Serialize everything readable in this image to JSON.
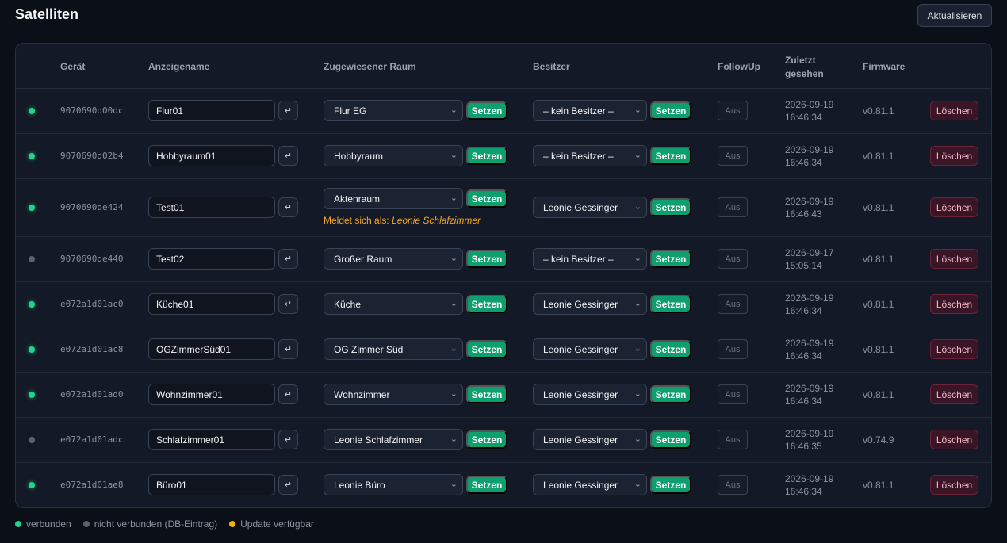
{
  "page": {
    "title": "Satelliten",
    "refresh_label": "Aktualisieren"
  },
  "table": {
    "headers": {
      "device": "Gerät",
      "display_name": "Anzeigename",
      "room": "Zugewiesener Raum",
      "owner": "Besitzer",
      "followup": "FollowUp",
      "last_seen_1": "Zuletzt",
      "last_seen_2": "gesehen",
      "firmware": "Firmware"
    },
    "set_label": "Setzen",
    "enter_icon": "↵",
    "delete_label": "Löschen",
    "reports_as_prefix": "Meldet sich als:",
    "rows": [
      {
        "connected": true,
        "device_id": "9070690d00dc",
        "name": "Flur01",
        "room": "Flur EG",
        "owner": "– kein Besitzer –",
        "followup": "Aus",
        "seen_date": "2026-09-19",
        "seen_time": "16:46:34",
        "firmware": "v0.81.1",
        "reports_as": ""
      },
      {
        "connected": true,
        "device_id": "9070690d02b4",
        "name": "Hobbyraum01",
        "room": "Hobbyraum",
        "owner": "– kein Besitzer –",
        "followup": "Aus",
        "seen_date": "2026-09-19",
        "seen_time": "16:46:34",
        "firmware": "v0.81.1",
        "reports_as": ""
      },
      {
        "connected": true,
        "device_id": "9070690de424",
        "name": "Test01",
        "room": "Aktenraum",
        "owner": "Leonie Gessinger",
        "followup": "Aus",
        "seen_date": "2026-09-19",
        "seen_time": "16:46:43",
        "firmware": "v0.81.1",
        "reports_as": "Leonie Schlafzimmer"
      },
      {
        "connected": false,
        "device_id": "9070690de440",
        "name": "Test02",
        "room": "Großer Raum",
        "owner": "– kein Besitzer –",
        "followup": "Aus",
        "seen_date": "2026-09-17",
        "seen_time": "15:05:14",
        "firmware": "v0.81.1",
        "reports_as": ""
      },
      {
        "connected": true,
        "device_id": "e072a1d01ac0",
        "name": "Küche01",
        "room": "Küche",
        "owner": "Leonie Gessinger",
        "followup": "Aus",
        "seen_date": "2026-09-19",
        "seen_time": "16:46:34",
        "firmware": "v0.81.1",
        "reports_as": ""
      },
      {
        "connected": true,
        "device_id": "e072a1d01ac8",
        "name": "OGZimmerSüd01",
        "room": "OG Zimmer Süd",
        "owner": "Leonie Gessinger",
        "followup": "Aus",
        "seen_date": "2026-09-19",
        "seen_time": "16:46:34",
        "firmware": "v0.81.1",
        "reports_as": ""
      },
      {
        "connected": true,
        "device_id": "e072a1d01ad0",
        "name": "Wohnzimmer01",
        "room": "Wohnzimmer",
        "owner": "Leonie Gessinger",
        "followup": "Aus",
        "seen_date": "2026-09-19",
        "seen_time": "16:46:34",
        "firmware": "v0.81.1",
        "reports_as": ""
      },
      {
        "connected": false,
        "device_id": "e072a1d01adc",
        "name": "Schlafzimmer01",
        "room": "Leonie Schlafzimmer",
        "owner": "Leonie Gessinger",
        "followup": "Aus",
        "seen_date": "2026-09-19",
        "seen_time": "16:46:35",
        "firmware": "v0.74.9",
        "reports_as": ""
      },
      {
        "connected": true,
        "device_id": "e072a1d01ae8",
        "name": "Büro01",
        "room": "Leonie Büro",
        "owner": "Leonie Gessinger",
        "followup": "Aus",
        "seen_date": "2026-09-19",
        "seen_time": "16:46:34",
        "firmware": "v0.81.1",
        "reports_as": ""
      }
    ]
  },
  "legend": {
    "connected": "verbunden",
    "disconnected": "nicht verbunden (DB-Eintrag)",
    "update": "Update verfügbar"
  },
  "colors": {
    "connected": "#22d38a",
    "disconnected": "#5b6270",
    "update": "#f5b300",
    "set_button": "#0e9f6e",
    "delete_button": "#3a1526",
    "reports_as": "#f5a524"
  }
}
